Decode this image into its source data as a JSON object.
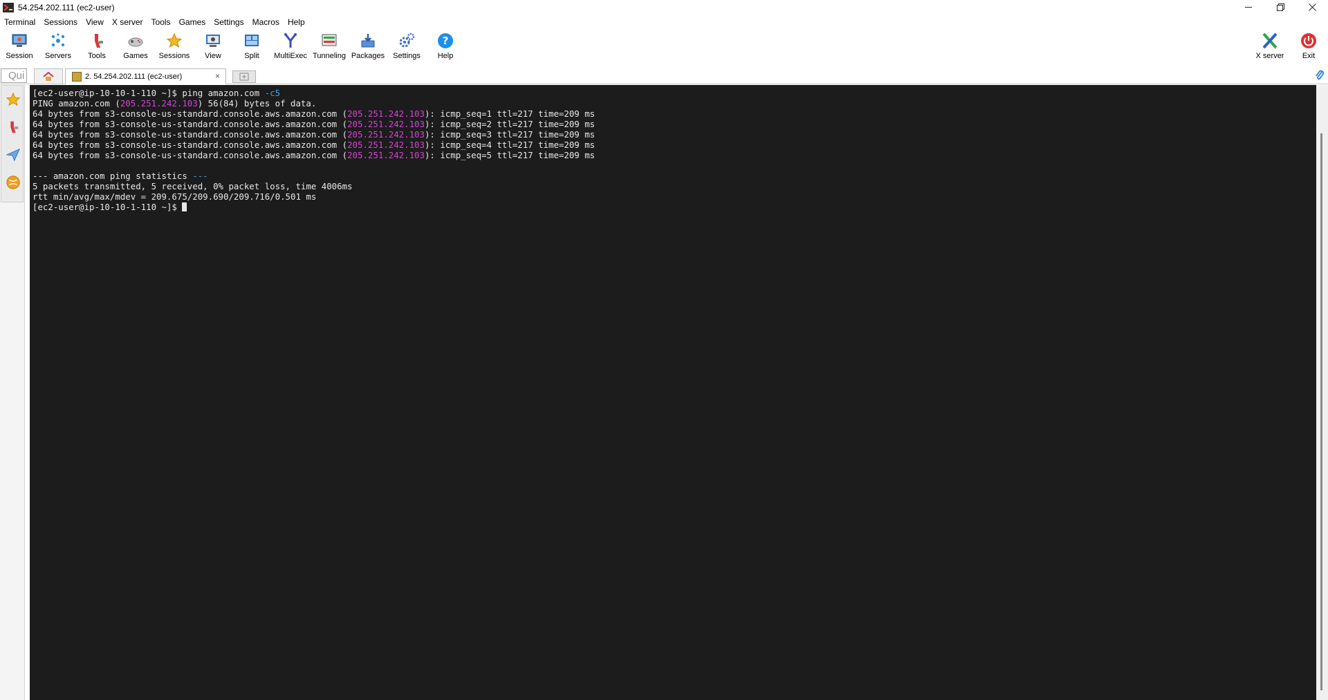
{
  "window": {
    "title": "54.254.202.111 (ec2-user)",
    "controls": {
      "minimize": "—",
      "restore": "❐",
      "close": "✕"
    }
  },
  "menu": [
    "Terminal",
    "Sessions",
    "View",
    "X server",
    "Tools",
    "Games",
    "Settings",
    "Macros",
    "Help"
  ],
  "toolbar": {
    "left": [
      {
        "label": "Session",
        "icon": "session-icon"
      },
      {
        "label": "Servers",
        "icon": "servers-icon"
      },
      {
        "label": "Tools",
        "icon": "tools-icon"
      },
      {
        "label": "Games",
        "icon": "games-icon"
      },
      {
        "label": "Sessions",
        "icon": "sessions-star-icon"
      },
      {
        "label": "View",
        "icon": "view-icon"
      },
      {
        "label": "Split",
        "icon": "split-icon"
      },
      {
        "label": "MultiExec",
        "icon": "multiexec-icon"
      },
      {
        "label": "Tunneling",
        "icon": "tunneling-icon"
      },
      {
        "label": "Packages",
        "icon": "packages-icon"
      },
      {
        "label": "Settings",
        "icon": "settings-icon"
      },
      {
        "label": "Help",
        "icon": "help-icon"
      }
    ],
    "right": [
      {
        "label": "X server",
        "icon": "xserver-icon"
      },
      {
        "label": "Exit",
        "icon": "power-icon"
      }
    ]
  },
  "tabs": {
    "quick_connect_placeholder": "Quick connect...",
    "quick_connect_visible": "Qui",
    "session_tab_label": "2. 54.254.202.111 (ec2-user)",
    "close_glyph": "×"
  },
  "terminal": {
    "lines": [
      [
        {
          "t": "[ec2-user@ip-10-10-1-110 ~]$ ping amazon.com "
        },
        {
          "t": "-c5",
          "c": "dim"
        }
      ],
      [
        {
          "t": "PING amazon.com ("
        },
        {
          "t": "205.251.242.103",
          "c": "ip"
        },
        {
          "t": ") 56(84) bytes of data."
        }
      ],
      [
        {
          "t": "64 bytes from s3-console-us-standard.console.aws.amazon.com ("
        },
        {
          "t": "205.251.242.103",
          "c": "ip"
        },
        {
          "t": "): icmp_seq=1 ttl=217 time=209 ms"
        }
      ],
      [
        {
          "t": "64 bytes from s3-console-us-standard.console.aws.amazon.com ("
        },
        {
          "t": "205.251.242.103",
          "c": "ip"
        },
        {
          "t": "): icmp_seq=2 ttl=217 time=209 ms"
        }
      ],
      [
        {
          "t": "64 bytes from s3-console-us-standard.console.aws.amazon.com ("
        },
        {
          "t": "205.251.242.103",
          "c": "ip"
        },
        {
          "t": "): icmp_seq=3 ttl=217 time=209 ms"
        }
      ],
      [
        {
          "t": "64 bytes from s3-console-us-standard.console.aws.amazon.com ("
        },
        {
          "t": "205.251.242.103",
          "c": "ip"
        },
        {
          "t": "): icmp_seq=4 ttl=217 time=209 ms"
        }
      ],
      [
        {
          "t": "64 bytes from s3-console-us-standard.console.aws.amazon.com ("
        },
        {
          "t": "205.251.242.103",
          "c": "ip"
        },
        {
          "t": "): icmp_seq=5 ttl=217 time=209 ms"
        }
      ],
      [
        {
          "t": ""
        }
      ],
      [
        {
          "t": "--- amazon.com ping statistics "
        },
        {
          "t": "---",
          "c": "dim"
        }
      ],
      [
        {
          "t": "5 packets transmitted, 5 received, 0% packet loss, time 4006ms"
        }
      ],
      [
        {
          "t": "rtt min/avg/max/mdev = 209.675/209.690/209.716/0.501 ms"
        }
      ],
      [
        {
          "t": "[ec2-user@ip-10-10-1-110 ~]$ "
        },
        {
          "cursor": true
        }
      ]
    ]
  },
  "colors": {
    "terminal_bg": "#1c1c1c",
    "terminal_fg": "#e8e8e8",
    "ip_highlight": "#d642d6",
    "option_highlight": "#3aa3e0"
  }
}
